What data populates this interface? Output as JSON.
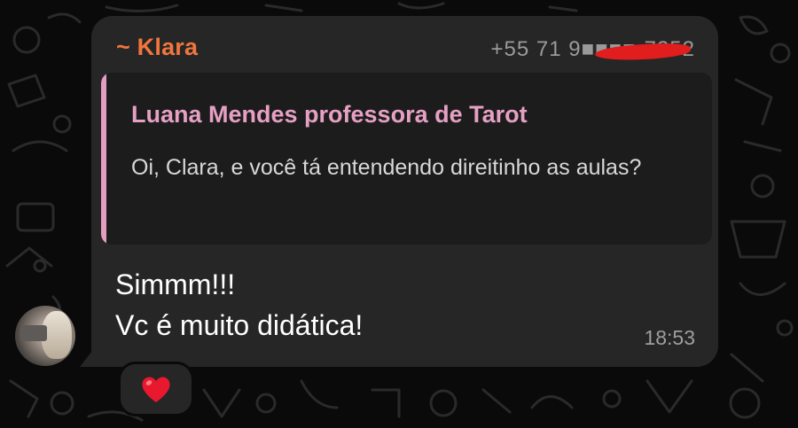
{
  "message": {
    "sender": "~ Klara",
    "phone": "+55 71 9■■■■-7252",
    "quoted": {
      "author": "Luana Mendes professora de Tarot",
      "text": "Oi, Clara, e você tá entendendo direitinho as aulas?"
    },
    "body_lines": [
      "Simmm!!!",
      "Vc é muito didática!"
    ],
    "time": "18:53",
    "reaction": "❤️"
  },
  "colors": {
    "background": "#0a0a0a",
    "bubble": "#262626",
    "quote_bg": "#1c1c1c",
    "sender": "#f0763d",
    "quote_accent": "#e49cc0",
    "redaction": "#e11d1d",
    "heart": "#e8182f"
  },
  "icons": {
    "avatar": "contact-avatar",
    "reaction": "red-heart-icon"
  }
}
